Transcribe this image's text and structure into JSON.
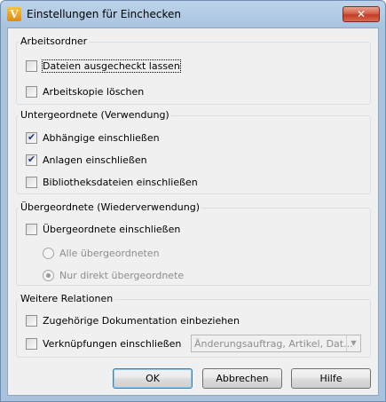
{
  "window": {
    "title": "Einstellungen für Einchecken",
    "app_icon_letter": "V",
    "close_symbol": "✕"
  },
  "groups": {
    "arbeitsordner": {
      "label": "Arbeitsordner",
      "options": [
        {
          "label": "Dateien ausgecheckt lassen",
          "checked": false
        },
        {
          "label": "Arbeitskopie löschen",
          "checked": false
        }
      ]
    },
    "untergeordnete": {
      "label": "Untergeordnete (Verwendung)",
      "options": [
        {
          "label": "Abhängige einschließen",
          "checked": true
        },
        {
          "label": "Anlagen einschließen",
          "checked": true
        },
        {
          "label": "Bibliotheksdateien einschließen",
          "checked": false
        }
      ]
    },
    "uebergeordnete": {
      "label": "Übergeordnete (Wiederverwendung)",
      "include_label": "Übergeordnete einschließen",
      "include_checked": false,
      "radios": [
        {
          "label": "Alle übergeordneten",
          "selected": false
        },
        {
          "label": "Nur direkt übergeordnete",
          "selected": true
        }
      ]
    },
    "weitere": {
      "label": "Weitere Relationen",
      "options": [
        {
          "label": "Zugehörige Dokumentation einbeziehen",
          "checked": false
        },
        {
          "label": "Verknüpfungen einschließen",
          "checked": false
        }
      ],
      "combo_value": "Änderungsauftrag, Artikel, Dat..."
    }
  },
  "buttons": {
    "ok": "OK",
    "cancel": "Abbrechen",
    "help": "Hilfe"
  }
}
